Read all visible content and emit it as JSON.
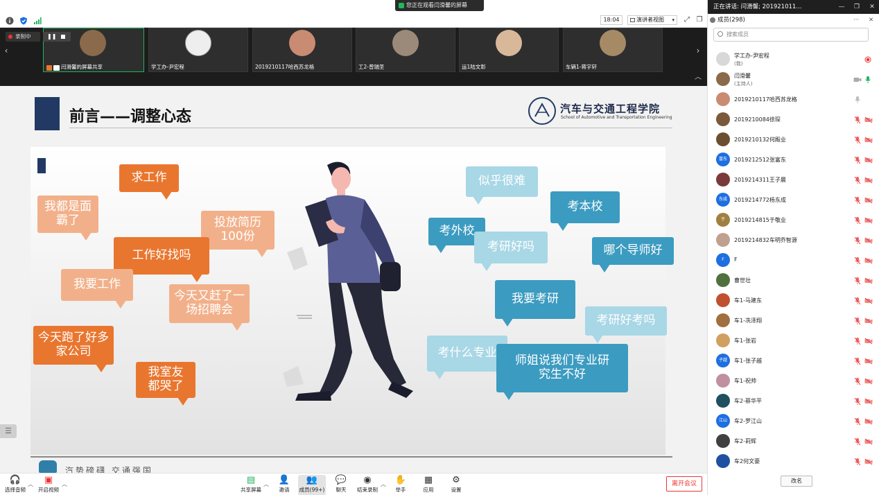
{
  "banner": {
    "share_text": "您正在观看闫滑馨的屏幕"
  },
  "topbar": {
    "clock": "18:04",
    "view_label": "演讲者视图"
  },
  "video_strip": {
    "recording_label": "录制中",
    "tiles": [
      {
        "name": "闫滑馨的屏幕共享",
        "avatar_color": "#8a6a4a"
      },
      {
        "name": "学工办-尹宏程",
        "avatar_color": "#dddddd"
      },
      {
        "name": "2019210117哈西苏龙格",
        "avatar_color": "#c98b72"
      },
      {
        "name": "工2-曾瑞圣",
        "avatar_color": "#9b8a7a"
      },
      {
        "name": "运1陆文彰",
        "avatar_color": "#d9b89a"
      },
      {
        "name": "车辆1-蒋宇轩",
        "avatar_color": "#a68a66"
      }
    ]
  },
  "slide": {
    "title": "前言——调整心态",
    "logo_cn": "汽车与交通工程学院",
    "logo_en": "School of Automotive and Transportation Engineering",
    "footer": "汽势磅礴 交通强国",
    "bubbles_left": [
      "求工作",
      "我都是面霸了",
      "投放简历100份",
      "工作好找吗",
      "我要工作",
      "今天又赶了一场招聘会",
      "今天跑了好多家公司",
      "我室友都哭了"
    ],
    "bubbles_right": [
      "似乎很难",
      "考本校",
      "考外校",
      "考研好吗",
      "哪个导师好",
      "我要考研",
      "考研好考吗",
      "考什么专业",
      "师姐说我们专业研究生不好"
    ]
  },
  "toolbar": {
    "audio": "选择音频",
    "video": "开启视频",
    "share": "共享屏幕",
    "invite": "邀请",
    "members": "成员(99+)",
    "chat": "聊天",
    "record": "结束录制",
    "raise_hand": "举手",
    "apps": "应用",
    "settings": "设置",
    "leave": "离开会议"
  },
  "panel": {
    "window_title": "正在讲话: 闫滑馨; 201921011...",
    "header": "成员(298)",
    "search_placeholder": "搜索成员",
    "rename": "改名",
    "members": [
      {
        "name": "学工办-尹宏程",
        "sub": "(我)",
        "avatar": "",
        "color": "#d8d8d8",
        "mic": "rec",
        "cam": "none"
      },
      {
        "name": "闫滑馨",
        "sub": "(主持人)",
        "avatar": "",
        "color": "#8a6a4a",
        "mic": "on",
        "cam": "gray"
      },
      {
        "name": "2019210117哈西苏龙格",
        "sub": "",
        "avatar": "",
        "color": "#c98b72",
        "mic": "gray",
        "cam": "none"
      },
      {
        "name": "2019210084徐琛",
        "sub": "",
        "avatar": "",
        "color": "#7a5a3a",
        "mic": "off",
        "cam": "off"
      },
      {
        "name": "2019210132何殿业",
        "sub": "",
        "avatar": "",
        "color": "#6a5030",
        "mic": "off",
        "cam": "off"
      },
      {
        "name": "2019212512张富东",
        "sub": "",
        "avatar": "富东",
        "color": "#1e6fe0",
        "mic": "off",
        "cam": "off"
      },
      {
        "name": "2019214311王子晨",
        "sub": "",
        "avatar": "",
        "color": "#7a3a3a",
        "mic": "off",
        "cam": "off"
      },
      {
        "name": "2019214772杨东成",
        "sub": "",
        "avatar": "东成",
        "color": "#1e6fe0",
        "mic": "off",
        "cam": "off"
      },
      {
        "name": "2019214815于敬业",
        "sub": "",
        "avatar": "于",
        "color": "#a08040",
        "mic": "off",
        "cam": "off"
      },
      {
        "name": "2019214832车明乔智源",
        "sub": "",
        "avatar": "",
        "color": "#c0a090",
        "mic": "off",
        "cam": "off"
      },
      {
        "name": "F",
        "sub": "",
        "avatar": "F",
        "color": "#1e6fe0",
        "mic": "off",
        "cam": "off"
      },
      {
        "name": "曹世壮",
        "sub": "",
        "avatar": "",
        "color": "#507040",
        "mic": "off",
        "cam": "off"
      },
      {
        "name": "车1-马建东",
        "sub": "",
        "avatar": "",
        "color": "#c05030",
        "mic": "off",
        "cam": "off"
      },
      {
        "name": "车1-冼泽翔",
        "sub": "",
        "avatar": "",
        "color": "#a07040",
        "mic": "off",
        "cam": "off"
      },
      {
        "name": "车1-张岩",
        "sub": "",
        "avatar": "",
        "color": "#d0a060",
        "mic": "off",
        "cam": "off"
      },
      {
        "name": "车1-张子越",
        "sub": "",
        "avatar": "子越",
        "color": "#1e6fe0",
        "mic": "off",
        "cam": "off"
      },
      {
        "name": "车1-祝帅",
        "sub": "",
        "avatar": "",
        "color": "#c090a0",
        "mic": "off",
        "cam": "off"
      },
      {
        "name": "车2-蔡华平",
        "sub": "",
        "avatar": "",
        "color": "#205060",
        "mic": "off",
        "cam": "off"
      },
      {
        "name": "车2-罗江山",
        "sub": "",
        "avatar": "江山",
        "color": "#1e6fe0",
        "mic": "off",
        "cam": "off"
      },
      {
        "name": "车2-莉辉",
        "sub": "",
        "avatar": "",
        "color": "#404040",
        "mic": "off",
        "cam": "off"
      },
      {
        "name": "车2何文豪",
        "sub": "",
        "avatar": "",
        "color": "#2050a0",
        "mic": "off",
        "cam": "off"
      }
    ]
  }
}
